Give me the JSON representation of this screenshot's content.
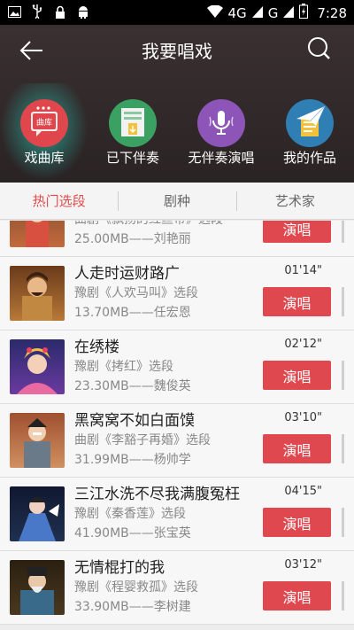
{
  "status_bar": {
    "network": "4G",
    "carrier": "G",
    "time": "7:28"
  },
  "header": {
    "title": "我要唱戏"
  },
  "categories": [
    {
      "label": "戏曲库",
      "badge": "曲库",
      "color": "#e0474d",
      "active": true
    },
    {
      "label": "已下伴奏",
      "color": "#3aa163"
    },
    {
      "label": "无伴奏演唱",
      "color": "#8d55b8"
    },
    {
      "label": "我的作品",
      "color": "#2f7fb5"
    }
  ],
  "tabs": [
    {
      "label": "热门选段",
      "active": true
    },
    {
      "label": "剧种"
    },
    {
      "label": "艺术家"
    }
  ],
  "sing_label": "演唱",
  "songs": [
    {
      "title": "",
      "subtitle": "曲剧《飘扬的红丝带》选段",
      "size_artist": "25.00MB——刘艳丽",
      "duration": ""
    },
    {
      "title": "人走时运财路广",
      "subtitle": "豫剧《人欢马叫》选段",
      "size_artist": "13.70MB——任宏恩",
      "duration": "01'14\""
    },
    {
      "title": "在绣楼",
      "subtitle": "豫剧《拷红》选段",
      "size_artist": "23.30MB——魏俊英",
      "duration": "02'12\""
    },
    {
      "title": "黑窝窝不如白面馍",
      "subtitle": "曲剧《李豁子再婚》选段",
      "size_artist": "31.99MB——杨帅学",
      "duration": "03'10\""
    },
    {
      "title": "三江水洗不尽我满腹冤枉",
      "subtitle": "豫剧《秦香莲》选段",
      "size_artist": "41.90MB——张宝英",
      "duration": "04'15\""
    },
    {
      "title": "无情棍打的我",
      "subtitle": "豫剧《程婴救孤》选段",
      "size_artist": "33.90MB——李树建",
      "duration": "03'12\""
    }
  ]
}
